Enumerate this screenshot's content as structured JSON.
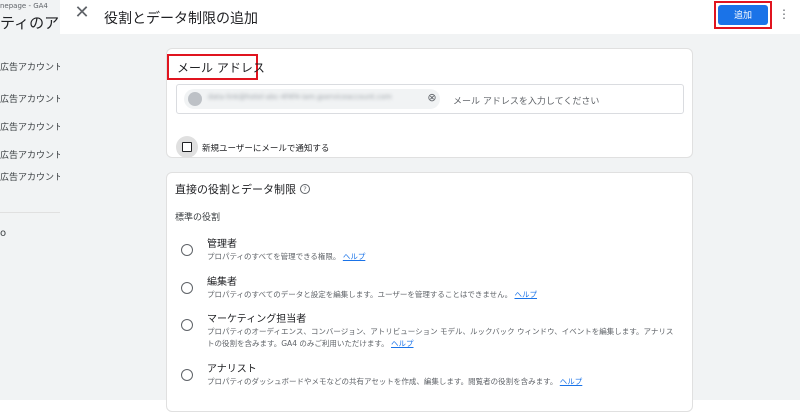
{
  "background": {
    "breadcrumb": "nepage - GA4",
    "title": "ティのアク",
    "rows": [
      "広告アカウント",
      "広告アカウント",
      "広告アカウント",
      "広告アカウント",
      "広告アカウント"
    ],
    "stray": "o"
  },
  "dialog": {
    "title": "役割とデータ制限の追加",
    "add_label": "追加",
    "close_icon": "close-icon",
    "more_icon": "more-vert-icon"
  },
  "email": {
    "heading": "メール アドレス",
    "chip_text": "data-link@hotel-abc-4f4f4-iam.gserviceaccount.com",
    "placeholder": "メール アドレスを入力してください",
    "notify_label": "新規ユーザーにメールで通知する"
  },
  "roles": {
    "heading": "直接の役割とデータ制限",
    "standard_heading": "標準の役割",
    "items": [
      {
        "name": "管理者",
        "desc": "プロパティのすべてを管理できる権限。",
        "link": "ヘルプ"
      },
      {
        "name": "編集者",
        "desc": "プロパティのすべてのデータと設定を編集します。ユーザーを管理することはできません。",
        "link": "ヘルプ"
      },
      {
        "name": "マーケティング担当者",
        "desc": "プロパティのオーディエンス、コンバージョン、アトリビューション モデル、ルックバック ウィンドウ、イベントを編集します。アナリストの役割を含みます。GA4 のみご利用いただけます。",
        "link": "ヘルプ"
      },
      {
        "name": "アナリスト",
        "desc": "プロパティのダッシュボードやメモなどの共有アセットを作成、編集します。閲覧者の役割を含みます。",
        "link": "ヘルプ"
      }
    ]
  },
  "colors": {
    "primary": "#1a73e8",
    "highlight_red": "#e0141f",
    "background": "#f1f3f4"
  }
}
